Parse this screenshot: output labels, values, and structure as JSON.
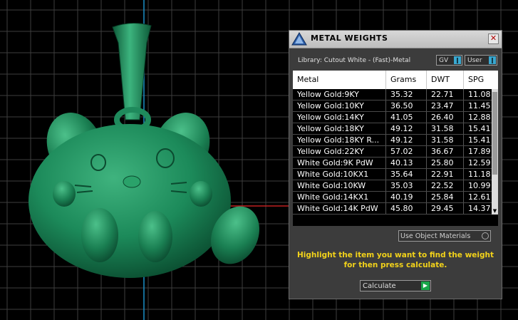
{
  "dialog": {
    "title": "METAL WEIGHTS",
    "close_glyph": "✕",
    "library_label": "Library: Cutout White - (Fast)-Metal",
    "gv_label": "GV",
    "user_label": "User",
    "arrow_glyph": "❙",
    "use_object_materials_label": "Use Object Materials",
    "instruction": "Highlight the item you want to find the weight for then press calculate.",
    "calculate_label": "Calculate",
    "play_glyph": "▶",
    "scroll_left_glyph": "◀",
    "scroll_right_glyph": "▶",
    "scroll_down_glyph": "▼"
  },
  "table": {
    "headers": [
      "Metal",
      "Grams",
      "DWT",
      "SPG"
    ],
    "rows": [
      [
        "Yellow Gold:9KY",
        "35.32",
        "22.71",
        "11.08"
      ],
      [
        "Yellow Gold:10KY",
        "36.50",
        "23.47",
        "11.45"
      ],
      [
        "Yellow Gold:14KY",
        "41.05",
        "26.40",
        "12.88"
      ],
      [
        "Yellow Gold:18KY",
        "49.12",
        "31.58",
        "15.41"
      ],
      [
        "Yellow Gold:18KY R...",
        "49.12",
        "31.58",
        "15.41"
      ],
      [
        "Yellow Gold:22KY",
        "57.02",
        "36.67",
        "17.89"
      ],
      [
        "White Gold:9K PdW",
        "40.13",
        "25.80",
        "12.59"
      ],
      [
        "White Gold:10KX1",
        "35.64",
        "22.91",
        "11.18"
      ],
      [
        "White Gold:10KW",
        "35.03",
        "22.52",
        "10.99"
      ],
      [
        "White Gold:14KX1",
        "40.19",
        "25.84",
        "12.61"
      ],
      [
        "White Gold:14K PdW",
        "45.80",
        "29.45",
        "14.37"
      ]
    ]
  },
  "icons": {
    "app_logo": "app-logo-icon",
    "close": "close-icon"
  },
  "colors": {
    "model_green": "#1f8a5c",
    "instruction_yellow": "#f2d21a",
    "viewport_grid": "#3a3a3a",
    "accent_blue": "#3aa8d0",
    "calc_green": "#19a64a"
  }
}
